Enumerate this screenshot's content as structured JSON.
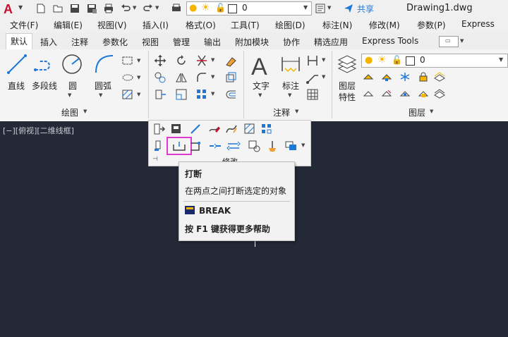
{
  "window": {
    "title": "Drawing1.dwg"
  },
  "quick_access": {
    "layer_value": "0",
    "share_label": "共享"
  },
  "menu": {
    "items": [
      "文件(F)",
      "编辑(E)",
      "视图(V)",
      "插入(I)",
      "格式(O)",
      "工具(T)",
      "绘图(D)",
      "标注(N)",
      "修改(M)",
      "参数(P)",
      "Express"
    ]
  },
  "tabs": {
    "items": [
      "默认",
      "插入",
      "注释",
      "参数化",
      "视图",
      "管理",
      "输出",
      "附加模块",
      "协作",
      "精选应用",
      "Express Tools"
    ],
    "active": "默认"
  },
  "ribbon": {
    "draw": {
      "line": "直线",
      "polyline": "多段线",
      "circle": "圆",
      "arc": "圆弧",
      "panel_title": "绘图"
    },
    "annotation": {
      "text": "文字",
      "dimension": "标注",
      "panel_title": "注释"
    },
    "layers": {
      "layer_props_line1": "图层",
      "layer_props_line2": "特性",
      "current_layer": "0",
      "panel_title": "图层"
    },
    "modify": {
      "panel_title": "修改"
    }
  },
  "viewport": {
    "label": "[−][俯视][二维线框]"
  },
  "tooltip": {
    "title": "打断",
    "description": "在两点之间打断选定的对象",
    "command": "BREAK",
    "help": "按 F1 键获得更多帮助"
  },
  "colors": {
    "accent_blue": "#1e78d6",
    "highlight": "#e23ad0",
    "canvas": "#232936",
    "bulb": "#f5b400"
  }
}
